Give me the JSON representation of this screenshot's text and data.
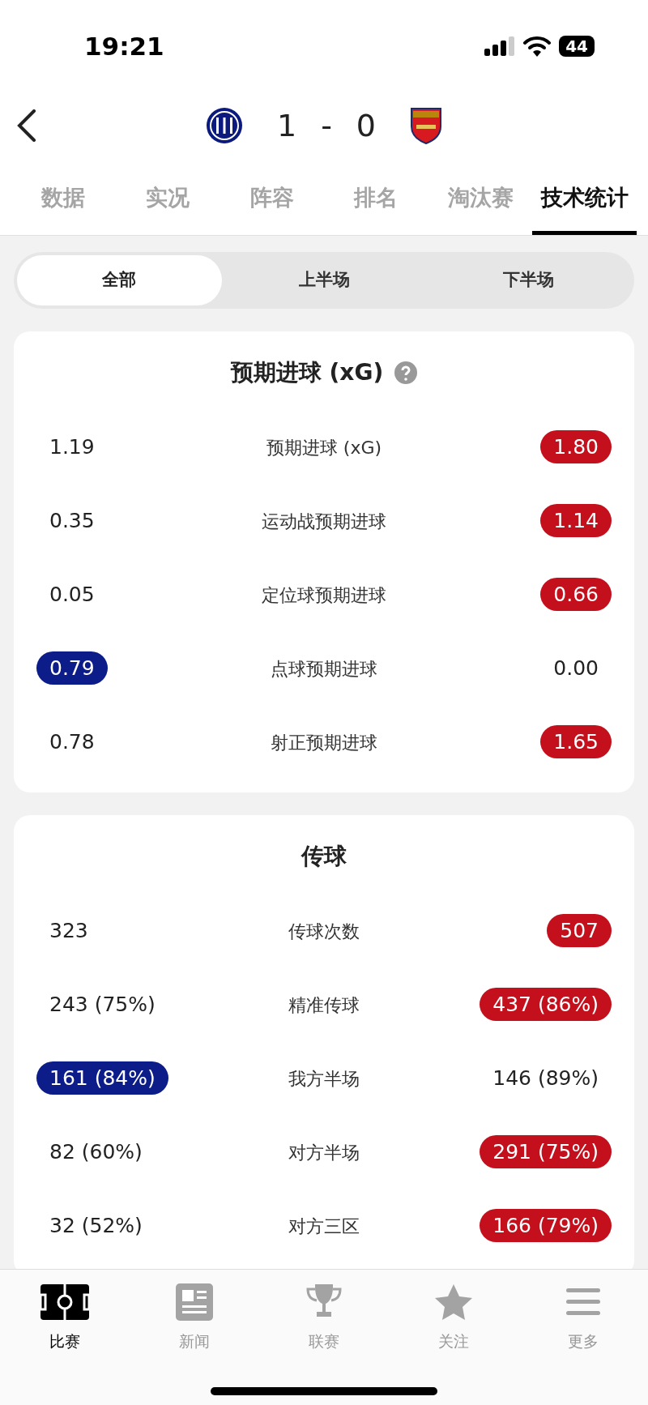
{
  "status_bar": {
    "time": "19:21",
    "battery": "44"
  },
  "match": {
    "home_score": "1",
    "separator": "-",
    "away_score": "0"
  },
  "tabs": [
    {
      "label": "数据",
      "selected": false
    },
    {
      "label": "实况",
      "selected": false
    },
    {
      "label": "阵容",
      "selected": false
    },
    {
      "label": "排名",
      "selected": false
    },
    {
      "label": "淘汰赛",
      "selected": false
    },
    {
      "label": "技术统计",
      "selected": true
    }
  ],
  "segments": [
    {
      "label": "全部",
      "selected": true
    },
    {
      "label": "上半场",
      "selected": false
    },
    {
      "label": "下半场",
      "selected": false
    }
  ],
  "sections": [
    {
      "title": "预期进球 (xG)",
      "help": true,
      "rows": [
        {
          "home": "1.19",
          "home_leads": false,
          "label": "预期进球 (xG)",
          "away": "1.80",
          "away_leads": true
        },
        {
          "home": "0.35",
          "home_leads": false,
          "label": "运动战预期进球",
          "away": "1.14",
          "away_leads": true
        },
        {
          "home": "0.05",
          "home_leads": false,
          "label": "定位球预期进球",
          "away": "0.66",
          "away_leads": true
        },
        {
          "home": "0.79",
          "home_leads": true,
          "label": "点球预期进球",
          "away": "0.00",
          "away_leads": false
        },
        {
          "home": "0.78",
          "home_leads": false,
          "label": "射正预期进球",
          "away": "1.65",
          "away_leads": true
        }
      ]
    },
    {
      "title": "传球",
      "help": false,
      "rows": [
        {
          "home": "323",
          "home_leads": false,
          "label": "传球次数",
          "away": "507",
          "away_leads": true
        },
        {
          "home": "243 (75%)",
          "home_leads": false,
          "label": "精准传球",
          "away": "437 (86%)",
          "away_leads": true
        },
        {
          "home": "161 (84%)",
          "home_leads": true,
          "label": "我方半场",
          "away": "146 (89%)",
          "away_leads": false
        },
        {
          "home": "82 (60%)",
          "home_leads": false,
          "label": "对方半场",
          "away": "291 (75%)",
          "away_leads": true
        },
        {
          "home": "32 (52%)",
          "home_leads": false,
          "label": "对方三区",
          "away": "166 (79%)",
          "away_leads": true
        }
      ]
    }
  ],
  "bottom_nav": [
    {
      "label": "比赛",
      "kind": "pitch",
      "selected": true
    },
    {
      "label": "新闻",
      "kind": "news",
      "selected": false
    },
    {
      "label": "联赛",
      "kind": "trophy",
      "selected": false
    },
    {
      "label": "关注",
      "kind": "star",
      "selected": false
    },
    {
      "label": "更多",
      "kind": "menu",
      "selected": false
    }
  ]
}
